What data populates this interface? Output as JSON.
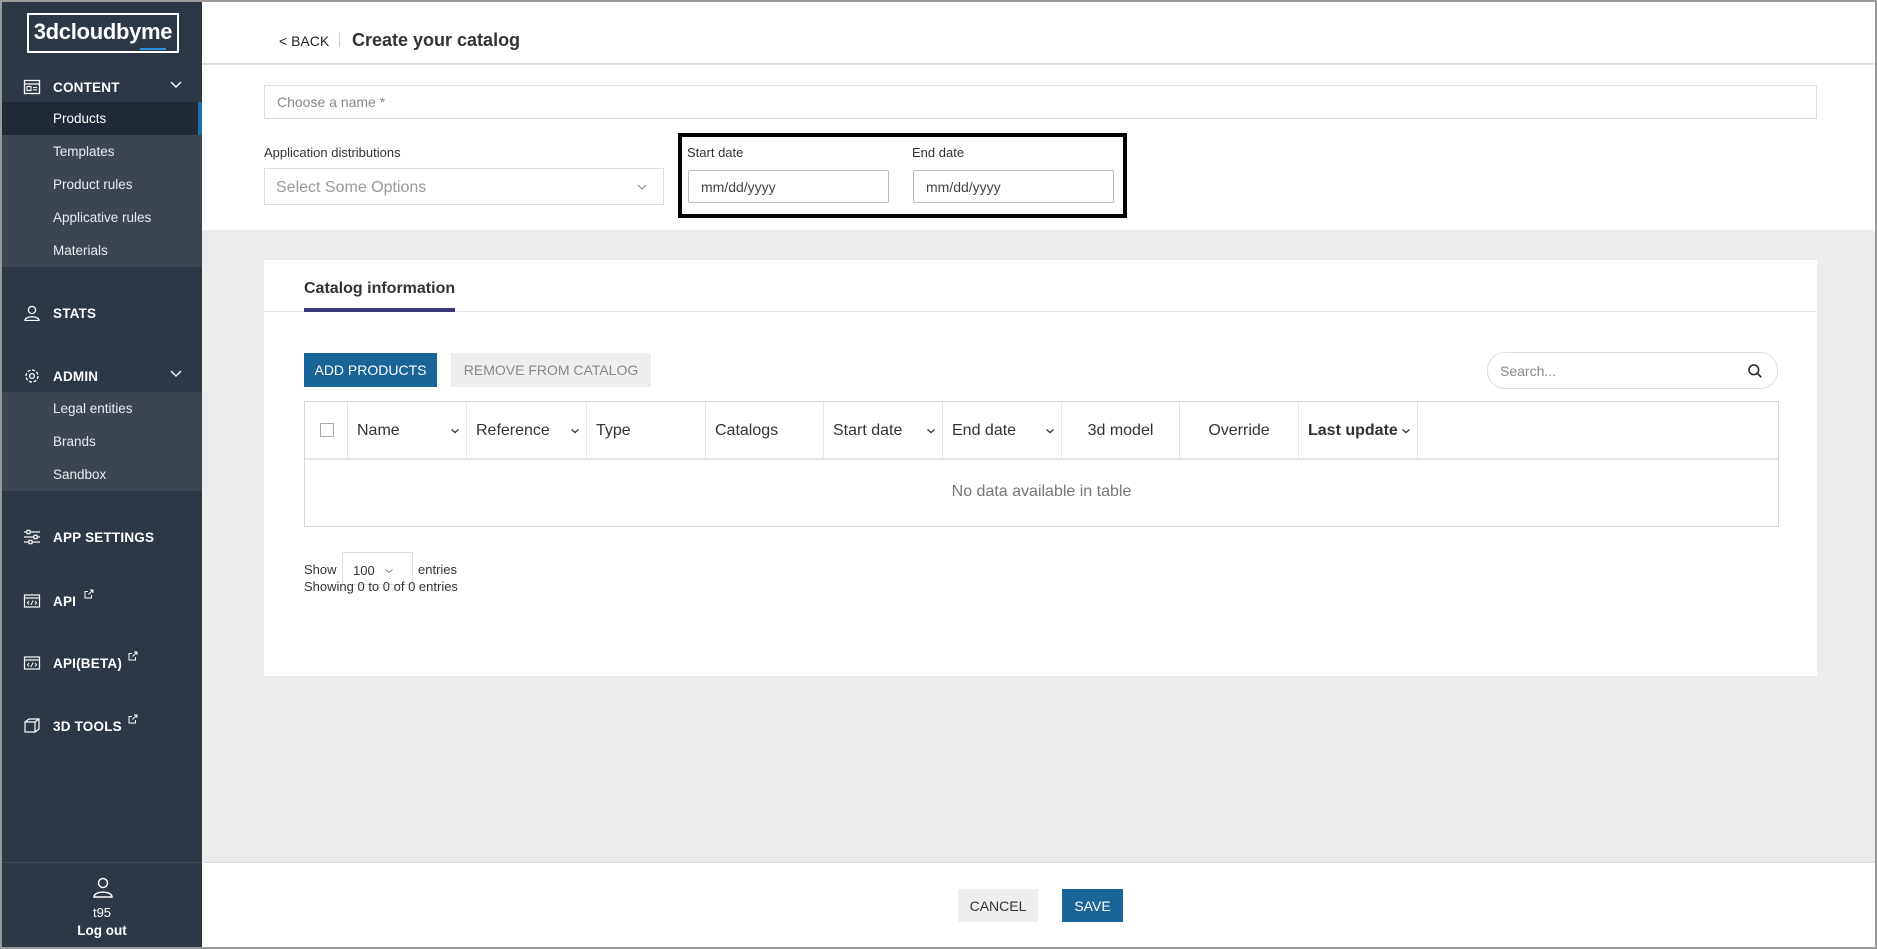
{
  "brand": {
    "logo_text": "3dcloudbyme",
    "accent": "#2e8fd8"
  },
  "colors": {
    "sidebar_bg": "#2c3845",
    "primary_button": "#1a6598",
    "active_tab_underline": "#3a3a7a"
  },
  "sidebar": {
    "content": {
      "label": "CONTENT",
      "icon": "content-icon"
    },
    "content_items": [
      {
        "label": "Products",
        "active": true
      },
      {
        "label": "Templates"
      },
      {
        "label": "Product rules"
      },
      {
        "label": "Applicative rules"
      },
      {
        "label": "Materials"
      }
    ],
    "stats": {
      "label": "STATS",
      "icon": "user-icon"
    },
    "admin": {
      "label": "ADMIN",
      "icon": "gear-icon"
    },
    "admin_items": [
      {
        "label": "Legal entities"
      },
      {
        "label": "Brands"
      },
      {
        "label": "Sandbox"
      }
    ],
    "app_settings": {
      "label": "APP SETTINGS",
      "icon": "sliders-icon"
    },
    "api": {
      "label": "API",
      "icon": "code-icon",
      "external": "external-link-icon"
    },
    "api_beta": {
      "label": "API(BETA)",
      "icon": "code-icon",
      "external": "external-link-icon"
    },
    "tools_3d": {
      "label": "3D TOOLS",
      "icon": "cube-icon",
      "external": "external-link-icon"
    },
    "user": {
      "name": "t95",
      "logout": "Log out"
    }
  },
  "header": {
    "back": "< BACK",
    "title": "Create your catalog"
  },
  "form": {
    "name_placeholder": "Choose a name *",
    "name_value": "",
    "distributions_label": "Application distributions",
    "distributions_placeholder": "Select Some Options",
    "start_date_label": "Start date",
    "start_date_placeholder": "mm/dd/yyyy",
    "end_date_label": "End date",
    "end_date_placeholder": "mm/dd/yyyy"
  },
  "catalog": {
    "tab": "Catalog information",
    "add_button": "ADD PRODUCTS",
    "remove_button": "REMOVE FROM CATALOG",
    "search_placeholder": "Search...",
    "columns": [
      "Name",
      "Reference",
      "Type",
      "Catalogs",
      "Start date",
      "End date",
      "3d model",
      "Override",
      "Last update"
    ],
    "empty_message": "No data available in table",
    "show_label": "Show",
    "entries_value": "100",
    "entries_label": "entries",
    "info": "Showing 0 to 0 of 0 entries"
  },
  "footer": {
    "cancel": "CANCEL",
    "save": "SAVE"
  }
}
